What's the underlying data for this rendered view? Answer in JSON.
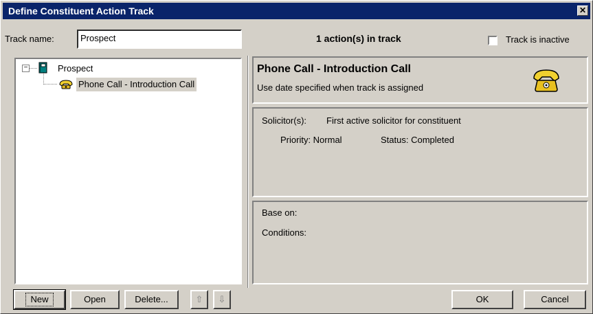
{
  "window": {
    "title": "Define Constituent Action Track",
    "close_label": "✕"
  },
  "track": {
    "name_label": "Track name:",
    "name_value": "Prospect",
    "count_text": "1 action(s) in track",
    "inactive_label": "Track is inactive"
  },
  "tree": {
    "expander": "−",
    "root_label": "Prospect",
    "child_label": "Phone Call - Introduction Call"
  },
  "detail": {
    "title": "Phone Call - Introduction Call",
    "subtitle": "Use date specified when track is assigned",
    "solicitor_label": "Solicitor(s):",
    "solicitor_value": "First active solicitor for constituent",
    "priority": "Priority: Normal",
    "status": "Status: Completed",
    "base_on_label": "Base on:",
    "conditions_label": "Conditions:"
  },
  "buttons": {
    "new": "New",
    "open": "Open",
    "delete": "Delete...",
    "up": "⇧",
    "down": "⇩",
    "ok": "OK",
    "cancel": "Cancel"
  },
  "colors": {
    "titlebar": "#0a246a",
    "face": "#d4d0c8",
    "selection": "#d4d0c8"
  }
}
